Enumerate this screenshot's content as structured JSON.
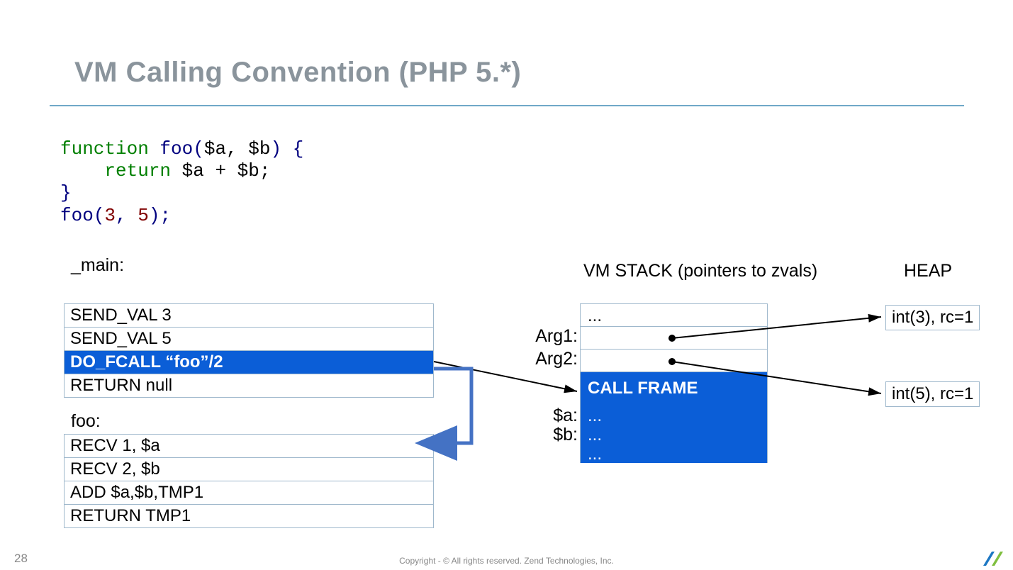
{
  "title": "VM Calling Convention (PHP 5.*)",
  "code": {
    "line1_kw": "function",
    "line1_fn": " foo",
    "line1_rest1": "(",
    "line1_var": "$a, $b",
    "line1_rest2": ") {",
    "line2_ret": "return",
    "line2_expr": " $a + $b;",
    "line3_brace": "}",
    "line4_fn": "foo",
    "line4_p1": "(",
    "line4_n1": "3",
    "line4_c": ", ",
    "line4_n2": "5",
    "line4_p2": ");"
  },
  "main_label": "_main:",
  "main_ops": [
    {
      "text": "SEND_VAL 3",
      "hl": false
    },
    {
      "text": "SEND_VAL 5",
      "hl": false
    },
    {
      "text": "DO_FCALL  “foo”/2",
      "hl": true
    },
    {
      "text": "RETURN null",
      "hl": false
    }
  ],
  "foo_label": "foo:",
  "foo_ops": [
    {
      "text": "RECV 1, $a",
      "hl": false
    },
    {
      "text": "RECV 2, $b",
      "hl": false
    },
    {
      "text": "ADD $a,$b,TMP1",
      "hl": false
    },
    {
      "text": "RETURN TMP1",
      "hl": false
    }
  ],
  "stack_title": "VM STACK (pointers to zvals)",
  "heap_title": "HEAP",
  "stack_labels": [
    "",
    "Arg1:",
    "Arg2:",
    "",
    "$a:",
    "$b:",
    ""
  ],
  "stack_rows": {
    "r0": "...",
    "r1": "",
    "r2": "",
    "callframe": "CALL FRAME",
    "r4": "...",
    "r5": "...",
    "r6": "..."
  },
  "heap": {
    "h1": "int(3), rc=1",
    "h2": "int(5), rc=1"
  },
  "footer": "Copyright - © All rights reserved. Zend Technologies, Inc.",
  "page": "28"
}
